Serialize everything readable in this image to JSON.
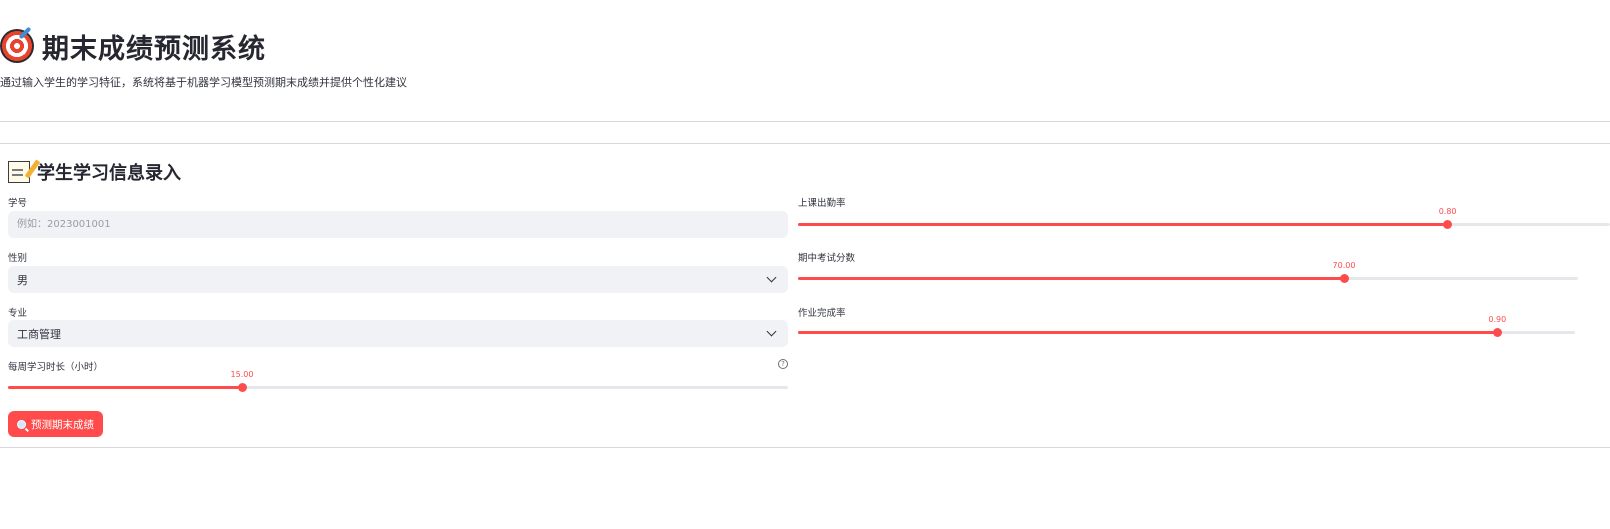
{
  "header": {
    "title": "期末成绩预测系统",
    "subtitle": "通过输入学生的学习特征，系统将基于机器学习模型预测期末成绩并提供个性化建议",
    "title_icon": "target-dart-icon"
  },
  "section": {
    "title": "学生学习信息录入",
    "icon": "memo-icon"
  },
  "form": {
    "student_id": {
      "label": "学号",
      "placeholder": "例如：2023001001",
      "value": ""
    },
    "gender": {
      "label": "性别",
      "value": "男"
    },
    "major": {
      "label": "专业",
      "value": "工商管理"
    },
    "weekly_hours": {
      "label": "每周学习时长（小时）",
      "value_text": "15.00",
      "fraction": 0.3
    },
    "attendance": {
      "label": "上课出勤率",
      "value_text": "0.80",
      "fraction": 0.8
    },
    "midterm": {
      "label": "期中考试分数",
      "value_text": "70.00",
      "fraction": 0.7
    },
    "homework": {
      "label": "作业完成率",
      "value_text": "0.90",
      "fraction": 0.9
    },
    "help_symbol": "?",
    "predict_button": "预测期末成绩"
  },
  "colors": {
    "accent": "#ff4b4b",
    "input_bg": "#f0f2f6",
    "text": "#31333f"
  }
}
